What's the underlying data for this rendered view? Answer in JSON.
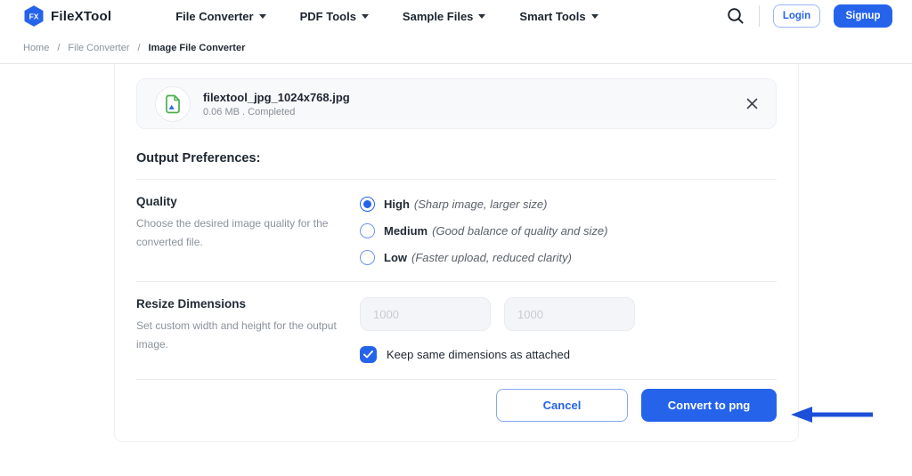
{
  "brand": {
    "logo_text": "FX",
    "name": "FileXTool"
  },
  "nav": {
    "items": [
      {
        "label": "File Converter"
      },
      {
        "label": "PDF Tools"
      },
      {
        "label": "Sample Files"
      },
      {
        "label": "Smart Tools"
      }
    ],
    "login_label": "Login",
    "signup_label": "Signup"
  },
  "breadcrumb": {
    "separator": "/",
    "items": [
      "Home",
      "File Converter",
      "Image File Converter"
    ]
  },
  "file_card": {
    "filename": "filextool_jpg_1024x768.jpg",
    "meta": "0.06 MB . Completed"
  },
  "output_preferences": {
    "heading": "Output Preferences:"
  },
  "quality": {
    "label": "Quality",
    "description": "Choose the desired image quality for the converted file.",
    "options": [
      {
        "label": "High",
        "note": "(Sharp image, larger size)",
        "selected": true
      },
      {
        "label": "Medium",
        "note": "(Good balance of quality and size)",
        "selected": false
      },
      {
        "label": "Low",
        "note": "(Faster upload, reduced clarity)",
        "selected": false
      }
    ]
  },
  "resize": {
    "label": "Resize Dimensions",
    "description": "Set custom width and height for the output image.",
    "width_placeholder": "1000",
    "height_placeholder": "1000",
    "checkbox_label": "Keep same dimensions as attached",
    "checkbox_checked": true
  },
  "footer": {
    "cancel_label": "Cancel",
    "convert_label": "Convert to png"
  },
  "colors": {
    "accent": "#2563eb",
    "arrow": "#1d4fd8",
    "icon_green": "#4caf50"
  }
}
